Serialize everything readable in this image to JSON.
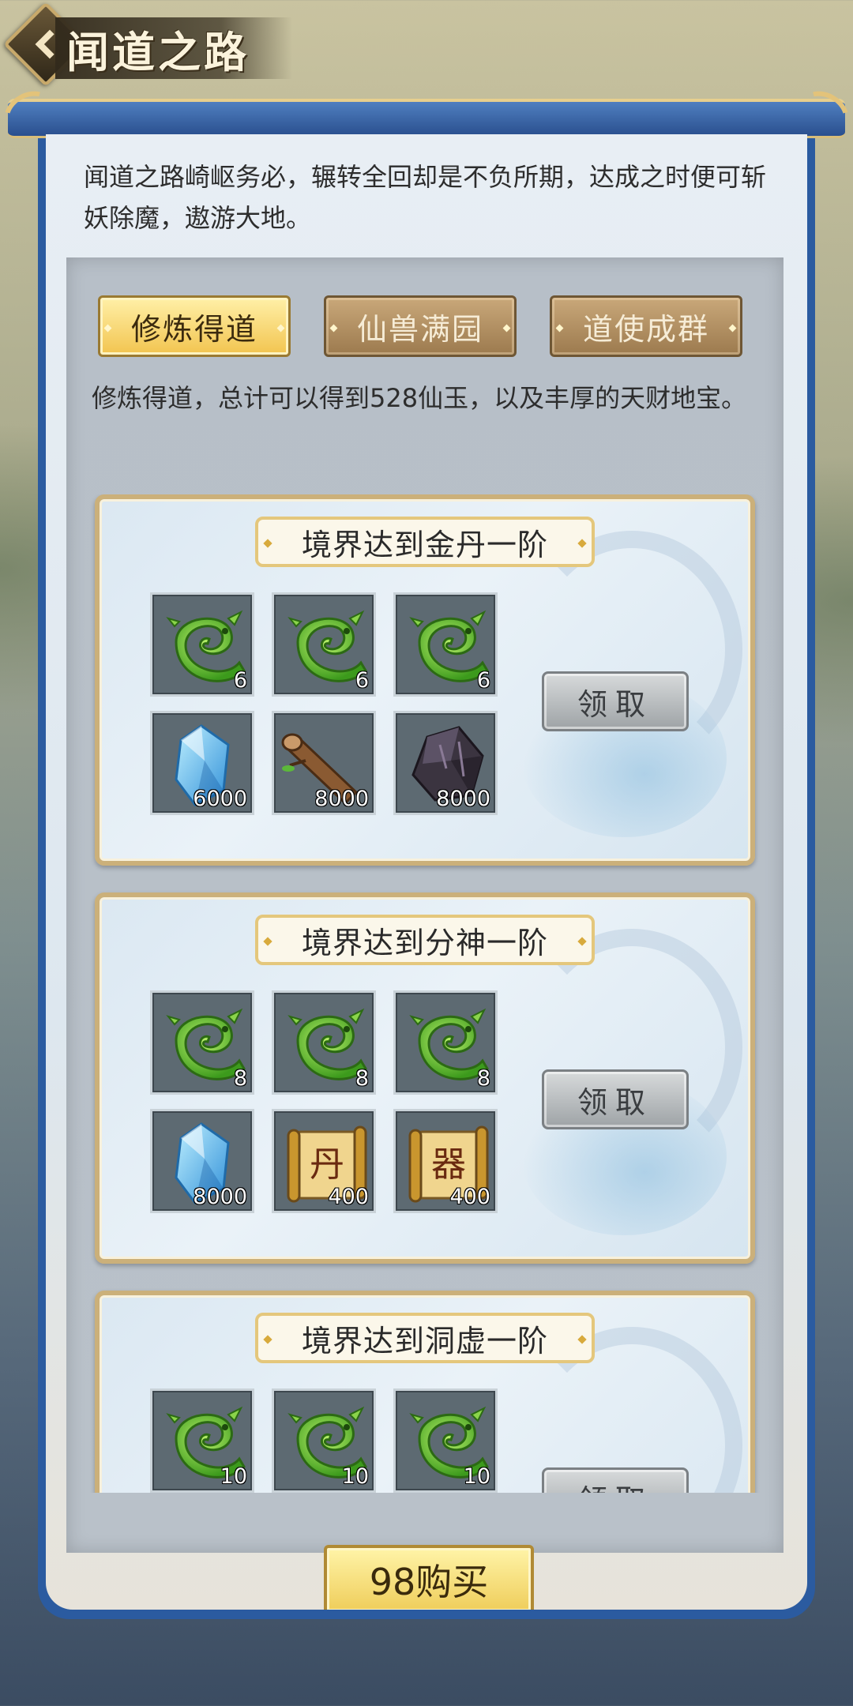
{
  "header": {
    "title": "闻道之路"
  },
  "intro": "闻道之路崎岖务必，辗转全回却是不负所期，达成之时便可斩妖除魔，遨游大地。",
  "tabs": [
    {
      "label": "修炼得道",
      "active": true
    },
    {
      "label": "仙兽满园",
      "active": false
    },
    {
      "label": "道使成群",
      "active": false
    }
  ],
  "tab_description": "修炼得道，总计可以得到528仙玉，以及丰厚的天财地宝。",
  "cards": [
    {
      "title": "境界达到金丹一阶",
      "claim_label": "领取",
      "items": [
        {
          "icon": "jade-dragon-icon",
          "qty": "6"
        },
        {
          "icon": "jade-dragon-icon",
          "qty": "6"
        },
        {
          "icon": "jade-dragon-icon",
          "qty": "6"
        },
        {
          "icon": "blue-crystal-icon",
          "qty": "6000"
        },
        {
          "icon": "wood-log-icon",
          "qty": "8000"
        },
        {
          "icon": "dark-ore-icon",
          "qty": "8000"
        }
      ]
    },
    {
      "title": "境界达到分神一阶",
      "claim_label": "领取",
      "items": [
        {
          "icon": "jade-dragon-icon",
          "qty": "8"
        },
        {
          "icon": "jade-dragon-icon",
          "qty": "8"
        },
        {
          "icon": "jade-dragon-icon",
          "qty": "8"
        },
        {
          "icon": "blue-crystal-icon",
          "qty": "8000"
        },
        {
          "icon": "scroll-icon",
          "qty": "400",
          "glyph": "丹"
        },
        {
          "icon": "scroll-icon",
          "qty": "400",
          "glyph": "器"
        }
      ]
    },
    {
      "title": "境界达到洞虚一阶",
      "claim_label": "领取",
      "items": [
        {
          "icon": "jade-dragon-icon",
          "qty": "10"
        },
        {
          "icon": "jade-dragon-icon",
          "qty": "10"
        },
        {
          "icon": "jade-dragon-icon",
          "qty": "10"
        }
      ]
    }
  ],
  "buy_button": {
    "label": "98购买"
  },
  "colors": {
    "frame_blue": "#2b5ba0",
    "gold": "#cbb07a",
    "active_tab": "#f2c44f",
    "inactive_tab": "#9c7a4e"
  }
}
